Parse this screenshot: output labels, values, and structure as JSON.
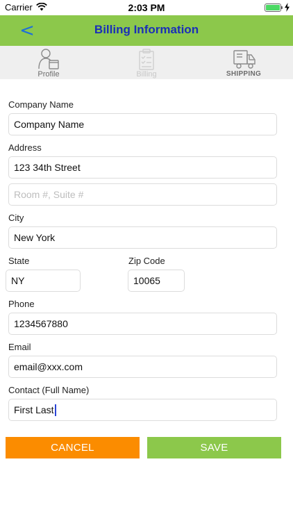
{
  "status_bar": {
    "carrier": "Carrier",
    "time": "2:03 PM",
    "battery_level": 1.0
  },
  "nav": {
    "back_label": "<",
    "title": "Billing Information"
  },
  "tabs": [
    {
      "label": "Profile",
      "icon": "profile-icon",
      "state": "normal"
    },
    {
      "label": "Billing",
      "icon": "clipboard-icon",
      "state": "disabled"
    },
    {
      "label": "SHIPPING",
      "icon": "truck-icon",
      "state": "normal"
    }
  ],
  "form": {
    "company": {
      "label": "Company Name",
      "value": "Company Name"
    },
    "address": {
      "label": "Address",
      "value": "123 34th Street",
      "line2_placeholder": "Room #, Suite #"
    },
    "city": {
      "label": "City",
      "value": "New York"
    },
    "state": {
      "label": "State",
      "value": "NY"
    },
    "zip": {
      "label": "Zip Code",
      "value": "10065"
    },
    "phone": {
      "label": "Phone",
      "value": "1234567880"
    },
    "email": {
      "label": "Email",
      "value": "email@xxx.com"
    },
    "contact": {
      "label": "Contact (Full Name)",
      "value": "First Last"
    }
  },
  "buttons": {
    "cancel": "CANCEL",
    "save": "SAVE"
  },
  "colors": {
    "nav_green": "#8cc84b",
    "title_blue": "#1a2fb8",
    "back_blue": "#1e6fd9",
    "cancel_orange": "#fb8c00",
    "save_green": "#8cc84b"
  }
}
